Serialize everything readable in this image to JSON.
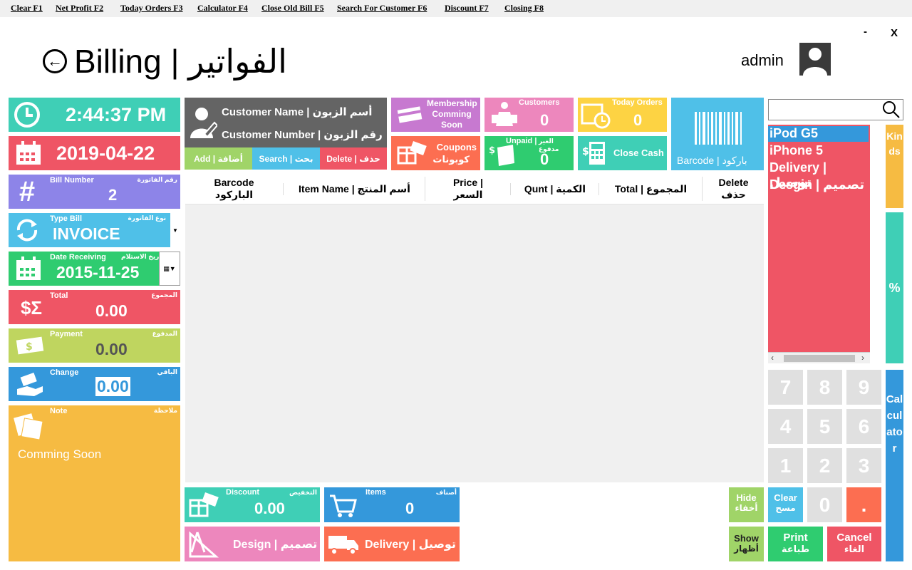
{
  "menu": [
    "Clear F1",
    "Net Profit F2",
    "Today Orders F3",
    "Calculator F4",
    "Close Old Bill F5",
    "Search For Customer F6",
    "Discount F7",
    "Closing F8"
  ],
  "window": {
    "minimize": "-",
    "close": "X"
  },
  "header": {
    "title": "Billing | الفواتير",
    "user": "admin"
  },
  "left": {
    "time": "2:44:37 PM",
    "date": "2019-04-22",
    "bill_number": {
      "label_en": "Bill Number",
      "label_ar": "رقم الفاتورة",
      "value": "2"
    },
    "type_bill": {
      "label_en": "Type Bill",
      "label_ar": "نوع الفاتورة",
      "value": "INVOICE"
    },
    "date_receiving": {
      "label_en": "Date Receiving",
      "label_ar": "تاريخ الاستلام",
      "value": "2015-11-25"
    },
    "total": {
      "label_en": "Total",
      "label_ar": "المجموع",
      "value": "0.00"
    },
    "payment": {
      "label_en": "Payment",
      "label_ar": "المدفوع",
      "value": "0.00"
    },
    "change": {
      "label_en": "Change",
      "label_ar": "الباقي",
      "value": "0.00"
    },
    "note": {
      "label_en": "Note",
      "label_ar": "ملاحظة",
      "value": "Comming Soon"
    }
  },
  "customer": {
    "name": "Customer Name | أسم الزبون",
    "number": "Customer Number | رقم الزبون",
    "add": "Add | أضافة",
    "search": "Search | بحث",
    "delete": "Delete | حذف"
  },
  "tiles": {
    "membership": "Membership Comming Soon",
    "coupons_en": "Coupons",
    "coupons_ar": "كوبونات",
    "customers_label": "Customers",
    "customers_value": "0",
    "unpaid_label_ar": "الغير مدفوع",
    "unpaid_label_en": "Unpaid |",
    "unpaid_value": "0",
    "today_orders_label": "Today Orders",
    "today_orders_value": "0",
    "close_cash": "Close Cash",
    "barcode": "Barcode | باركود"
  },
  "table": {
    "headers": [
      {
        "line1": "Barcode",
        "line2": "الباركود"
      },
      {
        "line1": "Item Name | أسم المنتج",
        "line2": ""
      },
      {
        "line1": "Price |",
        "line2": "السعر"
      },
      {
        "line1": "Qunt | الكمية",
        "line2": ""
      },
      {
        "line1": "Total | المجموع",
        "line2": ""
      },
      {
        "line1": "Delete",
        "line2": "حذف"
      }
    ]
  },
  "bottom": {
    "discount_en": "Discount",
    "discount_ar": "التخفيض",
    "discount_value": "0.00",
    "items_en": "Items",
    "items_ar": "أصناف",
    "items_value": "0",
    "design": "Design | تصميم",
    "delivery": "Delivery | توصيل"
  },
  "kinds_list": [
    "iPod G5",
    "iPhone 5",
    "Delivery | توصيل",
    "Desgin | تصميم"
  ],
  "side": {
    "kinds": "Kinds",
    "percent": "%",
    "calculator": "Calculator"
  },
  "keypad": [
    "7",
    "8",
    "9",
    "4",
    "5",
    "6",
    "1",
    "2",
    "3",
    "0",
    "."
  ],
  "actions": {
    "hide_en": "Hide",
    "hide_ar": "أخفاء",
    "clear_en": "Clear",
    "clear_ar": "مسح",
    "show_en": "Show",
    "show_ar": "أظهار",
    "print_en": "Print",
    "print_ar": "طباعة",
    "cancel_en": "Cancel",
    "cancel_ar": "الغاء"
  },
  "colors": {
    "teal": "#3fcfb6",
    "red": "#ef5565",
    "purple": "#8d84e8",
    "blue": "#4fc0e8",
    "green": "#2fcc70",
    "lime": "#a0d468",
    "olive": "#bfd55f",
    "dodger": "#3498db",
    "orange": "#f6bb42",
    "pink": "#ed87bd",
    "coral": "#fc6e51",
    "yellow": "#fdd343",
    "gray": "#646464",
    "violet": "#c779d0"
  }
}
